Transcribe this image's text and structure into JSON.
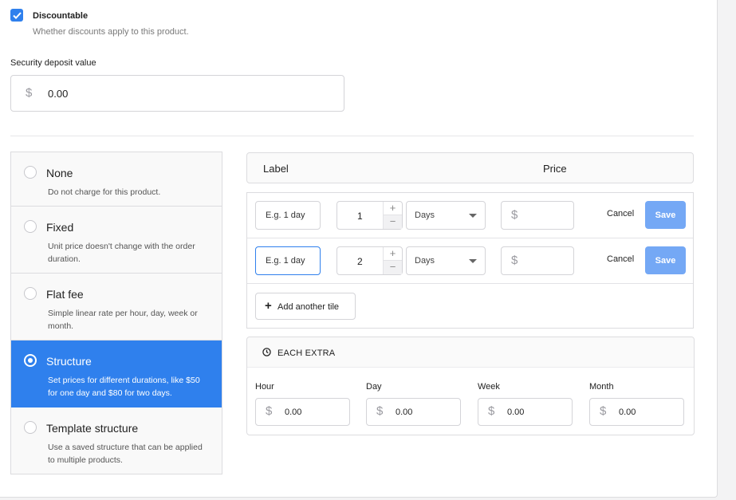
{
  "discount": {
    "checked": true,
    "title": "Discountable",
    "description": "Whether discounts apply to this product."
  },
  "deposit": {
    "label": "Security deposit value",
    "currency": "$",
    "value": "0.00"
  },
  "pricing_options": [
    {
      "title": "None",
      "description": "Do not charge for this product.",
      "selected": false
    },
    {
      "title": "Fixed",
      "description": "Unit price doesn't change with the order duration.",
      "selected": false
    },
    {
      "title": "Flat fee",
      "description": "Simple linear rate per hour, day, week or month.",
      "selected": false
    },
    {
      "title": "Structure",
      "description": "Set prices for different durations, like $50 for one day and $80 for two days.",
      "selected": true
    },
    {
      "title": "Template structure",
      "description": "Use a saved structure that can be applied to multiple products.",
      "selected": false
    }
  ],
  "structure": {
    "header": {
      "label": "Label",
      "price": "Price"
    },
    "rows": [
      {
        "label_placeholder": "E.g. 1 day",
        "quantity": "1",
        "unit": "Days",
        "currency": "$",
        "cancel": "Cancel",
        "save": "Save"
      },
      {
        "label_placeholder": "E.g. 1 day",
        "quantity": "2",
        "unit": "Days",
        "currency": "$",
        "cancel": "Cancel",
        "save": "Save"
      }
    ],
    "stepper": {
      "plus": "+",
      "minus": "−"
    },
    "add_tile": {
      "icon": "+",
      "label": "Add another tile"
    }
  },
  "extra": {
    "title": "EACH EXTRA",
    "fields": [
      {
        "label": "Hour",
        "currency": "$",
        "value": "0.00"
      },
      {
        "label": "Day",
        "currency": "$",
        "value": "0.00"
      },
      {
        "label": "Week",
        "currency": "$",
        "value": "0.00"
      },
      {
        "label": "Month",
        "currency": "$",
        "value": "0.00"
      }
    ]
  },
  "colors": {
    "accent": "#2f80ed",
    "save_button": "#74a8f5"
  }
}
